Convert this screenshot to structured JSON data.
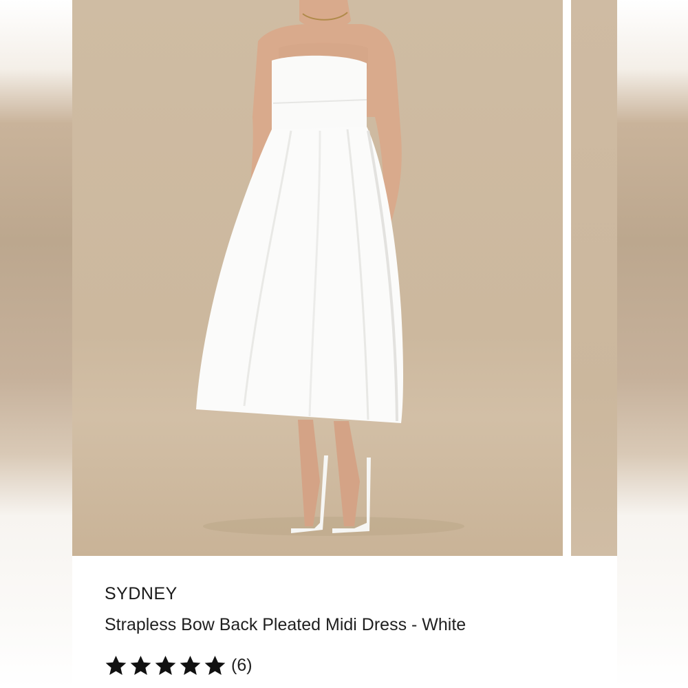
{
  "product": {
    "brand": "SYDNEY",
    "title": "Strapless Bow Back Pleated Midi Dress - White",
    "rating": 5,
    "rating_max": 5,
    "review_count": "(6)"
  },
  "colors": {
    "background_beige": "#cdb9a0",
    "dress_white": "#fbfbfa",
    "star": "#111111",
    "text": "#1f1f1f"
  },
  "icons": [
    "star-icon"
  ]
}
